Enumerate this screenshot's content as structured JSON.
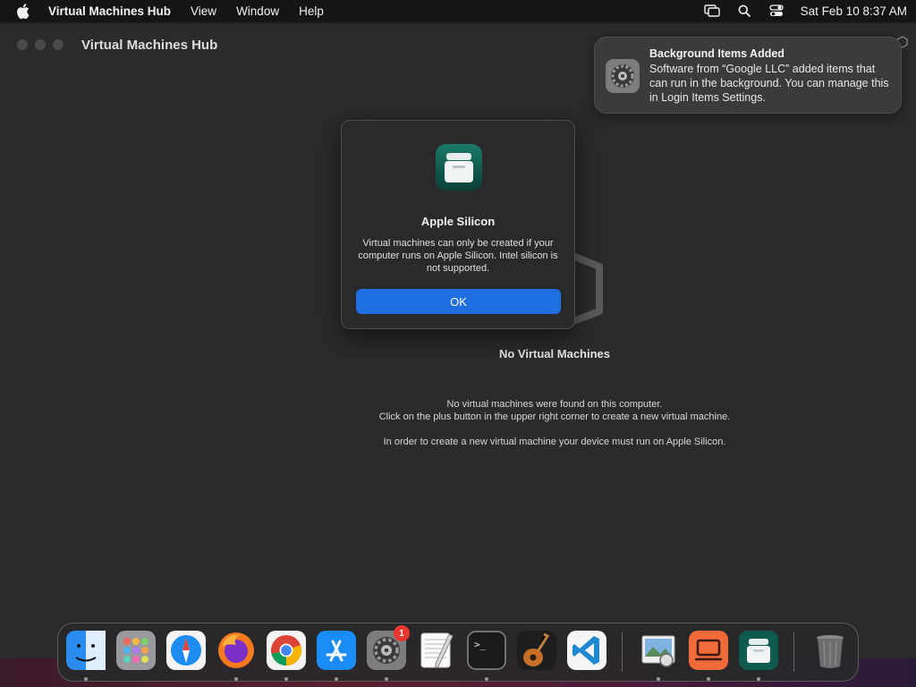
{
  "menubar": {
    "app_name": "Virtual Machines Hub",
    "menus": [
      "View",
      "Window",
      "Help"
    ],
    "clock": "Sat Feb 10  8:37 AM"
  },
  "window": {
    "title": "Virtual Machines Hub"
  },
  "empty_state": {
    "title": "No Virtual Machines",
    "line1": "No virtual machines were found on this computer.",
    "line2": "Click on the plus button in the upper right corner to create a new virtual machine.",
    "line3": "In order to create a new virtual machine your device must run on Apple Silicon."
  },
  "dialog": {
    "title": "Apple Silicon",
    "message": "Virtual machines can only be created if your computer runs on Apple Silicon. Intel silicon is not supported.",
    "ok_label": "OK"
  },
  "notification": {
    "title": "Background Items Added",
    "body": "Software from “Google LLC” added items that can run in the background. You can manage this in Login Items Settings."
  },
  "dock": {
    "items": [
      {
        "name": "finder",
        "icon": "finder-icon",
        "running": true
      },
      {
        "name": "launchpad",
        "icon": "launchpad-icon",
        "running": false
      },
      {
        "name": "safari",
        "icon": "safari-icon",
        "running": false
      },
      {
        "name": "firefox",
        "icon": "firefox-icon",
        "running": true
      },
      {
        "name": "chrome",
        "icon": "chrome-icon",
        "running": true
      },
      {
        "name": "app-store",
        "icon": "app-store-icon",
        "running": true
      },
      {
        "name": "system-settings",
        "icon": "system-settings-icon",
        "running": true,
        "badge": "1"
      },
      {
        "name": "textedit",
        "icon": "textedit-icon",
        "running": false
      },
      {
        "name": "terminal",
        "icon": "terminal-icon",
        "running": true
      },
      {
        "name": "garageband",
        "icon": "garageband-icon",
        "running": false
      },
      {
        "name": "vscode",
        "icon": "vscode-icon",
        "running": false
      },
      {
        "name": "preview",
        "icon": "preview-icon",
        "running": true
      },
      {
        "name": "remote-desktop",
        "icon": "remote-desktop-icon",
        "running": true
      },
      {
        "name": "virtual-machines-hub",
        "icon": "vm-hub-icon",
        "running": true
      },
      {
        "name": "trash",
        "icon": "trash-icon",
        "running": false
      }
    ]
  },
  "colors": {
    "accent": "#1f6fe0",
    "badge": "#e8372f",
    "window_bg": "#2b2b2d"
  }
}
